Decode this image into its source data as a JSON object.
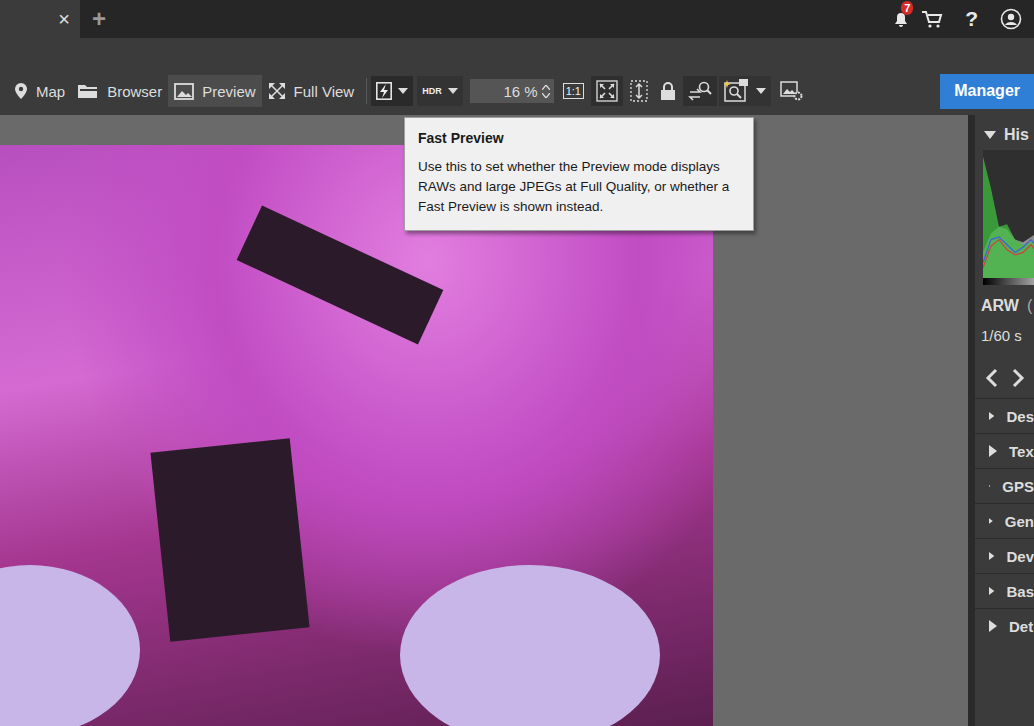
{
  "window_tabs": {
    "close": "×",
    "add": "+"
  },
  "header": {
    "notifications": "7",
    "help": "?"
  },
  "nav": [
    {
      "label": "Map",
      "selected": false
    },
    {
      "label": "Browser",
      "selected": false
    },
    {
      "label": "Preview",
      "selected": true
    },
    {
      "label": "Full View",
      "selected": false
    }
  ],
  "toolbar": {
    "fast_preview_active": true,
    "hdr": "HDR",
    "zoom": "16 %",
    "actual_size": "1:1",
    "manager": "Manager"
  },
  "tooltip": {
    "title": "Fast Preview",
    "body": "Use this to set whether the Preview mode displays RAWs and large JPEGs at Full Quality, or whether a Fast Preview is shown instead."
  },
  "side_panel": {
    "histogram_title": "His",
    "histogram_expanded": true,
    "histogram": [
      {
        "name": "luminance",
        "color": "#9a9a9a",
        "values": [
          20,
          35,
          40,
          38,
          30,
          28,
          32,
          36,
          30,
          45,
          40
        ]
      },
      {
        "name": "green",
        "color": "#3fbf3f",
        "values": [
          95,
          70,
          40,
          42,
          30,
          26,
          28,
          34,
          30,
          25,
          20
        ]
      },
      {
        "name": "red",
        "color": "#d04040",
        "values": [
          8,
          25,
          30,
          22,
          18,
          20,
          26,
          18,
          22,
          30,
          15
        ]
      },
      {
        "name": "blue",
        "color": "#4060e0",
        "values": [
          12,
          30,
          32,
          26,
          20,
          24,
          30,
          22,
          28,
          36,
          18
        ]
      }
    ],
    "format": "ARW",
    "format_extra": "(",
    "shutter": "1/60 s",
    "sections": [
      {
        "label": "Des",
        "expanded": false
      },
      {
        "label": "Tex",
        "expanded": false
      },
      {
        "label": "GPS",
        "expanded": false
      },
      {
        "label": "Gen",
        "expanded": false
      },
      {
        "label": "Dev",
        "expanded": false
      },
      {
        "label": "Bas",
        "expanded": false
      },
      {
        "label": "Det",
        "expanded": false
      }
    ]
  }
}
